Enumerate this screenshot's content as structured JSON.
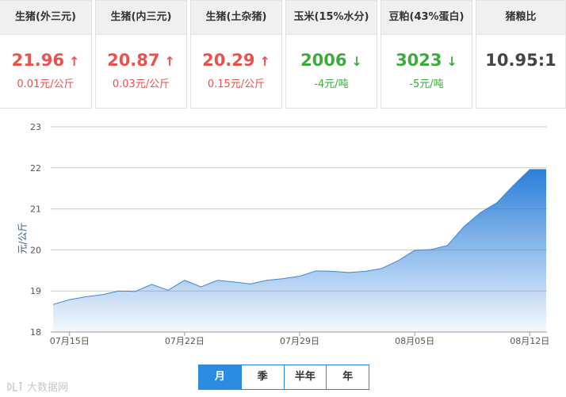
{
  "cards": [
    {
      "title": "生猪(外三元)",
      "value": "21.96",
      "arrow": "↑",
      "change": "0.01元/公斤",
      "trend": "up"
    },
    {
      "title": "生猪(内三元)",
      "value": "20.87",
      "arrow": "↑",
      "change": "0.03元/公斤",
      "trend": "up"
    },
    {
      "title": "生猪(土杂猪)",
      "value": "20.29",
      "arrow": "↑",
      "change": "0.15元/公斤",
      "trend": "up"
    },
    {
      "title": "玉米(15%水分)",
      "value": "2006",
      "arrow": "↓",
      "change": "-4元/吨",
      "trend": "down"
    },
    {
      "title": "豆粕(43%蛋白)",
      "value": "3023",
      "arrow": "↓",
      "change": "-5元/吨",
      "trend": "down"
    },
    {
      "title": "猪粮比",
      "value": "10.95:1",
      "arrow": "",
      "change": "",
      "trend": "neutral"
    }
  ],
  "chart_data": {
    "type": "area",
    "ylabel": "元/公斤",
    "ylim": [
      18,
      23
    ],
    "yticks": [
      "18",
      "19",
      "20",
      "21",
      "22",
      "23"
    ],
    "xticks": [
      {
        "label": "07月15日",
        "index": 1
      },
      {
        "label": "07月22日",
        "index": 8
      },
      {
        "label": "07月29日",
        "index": 15
      },
      {
        "label": "08月05日",
        "index": 22
      },
      {
        "label": "08月12日",
        "index": 29
      }
    ],
    "values": [
      18.67,
      18.79,
      18.86,
      18.91,
      19.0,
      18.99,
      19.16,
      19.02,
      19.26,
      19.1,
      19.26,
      19.22,
      19.17,
      19.26,
      19.3,
      19.36,
      19.49,
      19.48,
      19.45,
      19.48,
      19.55,
      19.74,
      19.99,
      20.01,
      20.11,
      20.57,
      20.91,
      21.15,
      21.57,
      21.96,
      21.96
    ],
    "grid": true,
    "color": "#2b7fd8"
  },
  "tabs": [
    {
      "label": "月",
      "active": true
    },
    {
      "label": "季",
      "active": false
    },
    {
      "label": "半年",
      "active": false
    },
    {
      "label": "年",
      "active": false
    }
  ],
  "watermark": "大数据网"
}
